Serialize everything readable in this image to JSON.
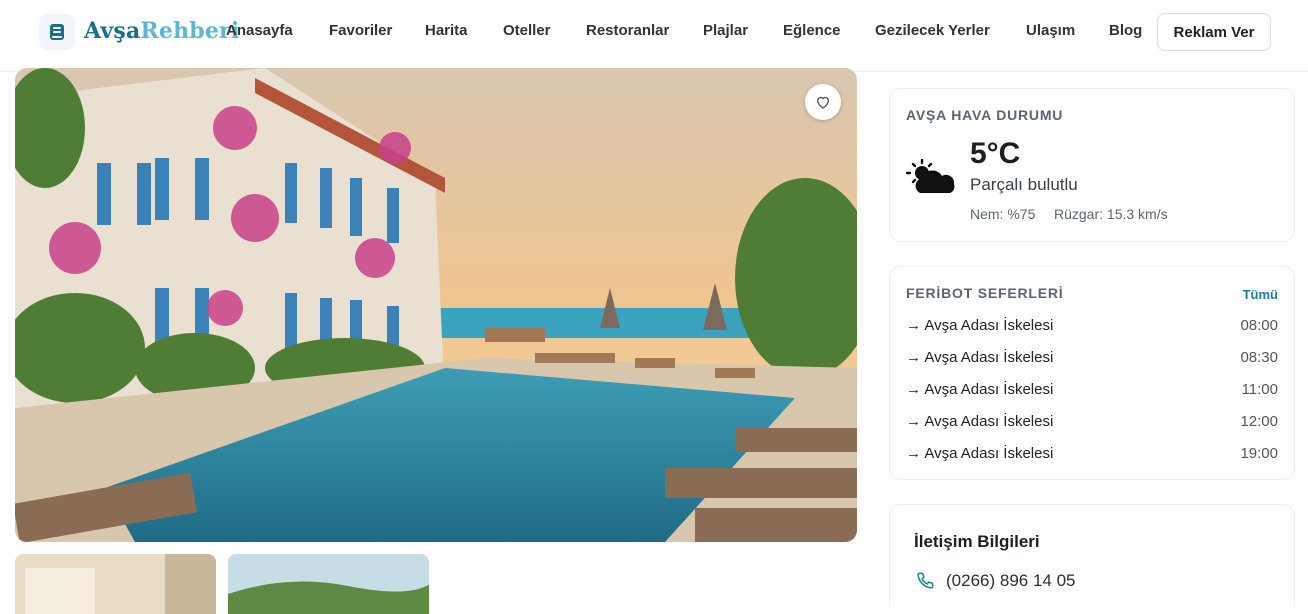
{
  "site": {
    "logo_part1": "Avşa",
    "logo_part2": "Rehberi"
  },
  "nav": {
    "items": [
      "Anasayfa",
      "Favoriler",
      "Harita",
      "Oteller",
      "Restoranlar",
      "Plajlar",
      "Eğlence",
      "Gezilecek Yerler",
      "Ulaşım",
      "Blog"
    ],
    "cta": "Reklam Ver"
  },
  "weather": {
    "title": "AVŞA HAVA DURUMU",
    "temperature": "5°C",
    "condition": "Parçalı bulutlu",
    "humidity": "Nem: %75",
    "wind": "Rüzgar: 15.3 km/s",
    "icon": "partly-cloudy-icon"
  },
  "ferry": {
    "title": "FERİBOT SEFERLERİ",
    "all_link": "Tümü",
    "rows": [
      {
        "dest": "→ Avşa Adası İskelesi",
        "time": "08:00"
      },
      {
        "dest": "→ Avşa Adası İskelesi",
        "time": "08:30"
      },
      {
        "dest": "→ Avşa Adası İskelesi",
        "time": "11:00"
      },
      {
        "dest": "→ Avşa Adası İskelesi",
        "time": "12:00"
      },
      {
        "dest": "→ Avşa Adası İskelesi",
        "time": "19:00"
      }
    ]
  },
  "contact": {
    "title": "İletişim Bilgileri",
    "phone": "(0266) 896 14 05"
  },
  "colors": {
    "brand_dark": "#1a6f8a",
    "brand_light": "#5fb6cf",
    "link": "#1a7f9c"
  }
}
